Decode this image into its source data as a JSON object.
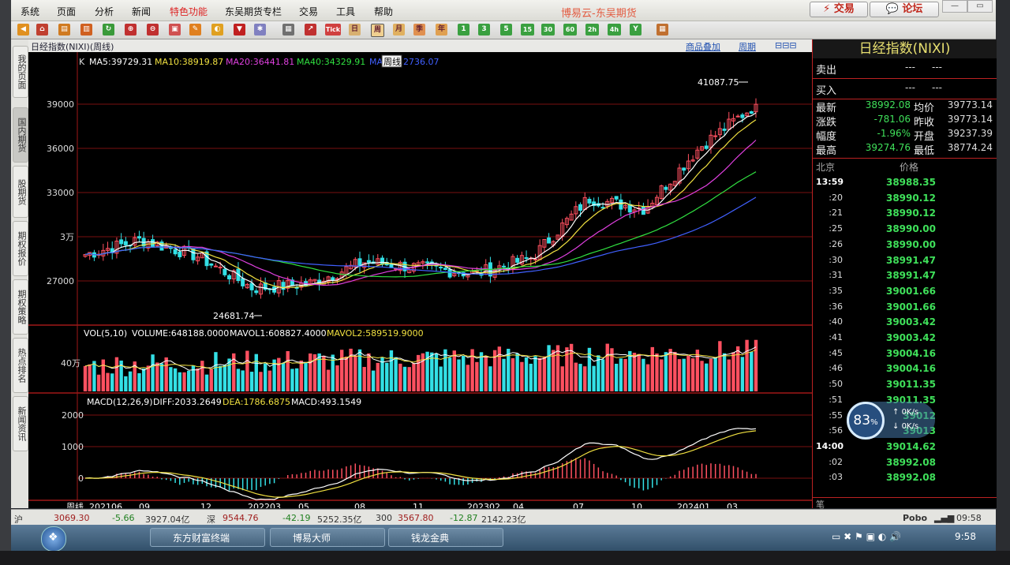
{
  "menu": [
    "系统",
    "页面",
    "分析",
    "新闻",
    "特色功能",
    "东吴期货专栏",
    "交易",
    "工具",
    "帮助"
  ],
  "app_title": "博易云-东吴期货",
  "top_buttons": {
    "trade": "交易",
    "forum": "论坛"
  },
  "toolbar_text": {
    "tick": "Tick",
    "period_buttons": [
      "日",
      "周",
      "月",
      "季",
      "年",
      "1",
      "3",
      "5",
      "15",
      "30",
      "60",
      "2h",
      "4h",
      "Y"
    ]
  },
  "chart": {
    "title": "日经指数(NIXI)(周线)",
    "links": {
      "overlay": "商品叠加",
      "period": "周期"
    },
    "ma_legend": {
      "k": "K",
      "ma5": "MA5:39729.31",
      "ma10": "MA10:38919.87",
      "ma20": "MA20:36441.81",
      "ma40": "MA40:34329.91",
      "ma60_prefix": "MA",
      "ma60": "2736.07"
    },
    "tooltip": "周线",
    "high_label": "41087.75",
    "low_label": "24681.74",
    "y_labels": [
      "39000",
      "36000",
      "33000",
      "3万",
      "27000"
    ],
    "vol_legend": {
      "title": "VOL(5,10)",
      "volume": "VOLUME:648188.0000",
      "mavol1": "MAVOL1:608827.4000",
      "mavol2": "MAVOL2:589519.9000"
    },
    "vol_axis": "40万",
    "macd_legend": {
      "title": "MACD(12,26,9)",
      "diff": "DIFF:2033.2649",
      "dea": "DEA:1786.6875",
      "macd": "MACD:493.1549"
    },
    "macd_axis": [
      "2000",
      "1000",
      "0"
    ],
    "x_labels": [
      "周线",
      "202106",
      "09",
      "12",
      "202203",
      "05",
      "08",
      "11",
      "202302",
      "04",
      "07",
      "10",
      "202401",
      "03"
    ],
    "colors": {
      "up": "#ff5060",
      "down": "#33e0e6",
      "ma5": "#ffffff",
      "ma10": "#f0e040",
      "ma20": "#e040e0",
      "ma40": "#30e040",
      "ma60": "#4060ff",
      "grid": "#a01818"
    }
  },
  "chart_data": {
    "type": "line",
    "title": "日经指数(NIXI)(周线)",
    "approx_close_by_period": {
      "x": [
        "202106",
        "202109",
        "202112",
        "202203",
        "202205",
        "202208",
        "202211",
        "202302",
        "202304",
        "202307",
        "202310",
        "202401",
        "202403"
      ],
      "close": [
        28800,
        29800,
        28700,
        26500,
        26800,
        28300,
        27900,
        27500,
        28600,
        32600,
        31900,
        36100,
        38992
      ]
    },
    "ylim": [
      23500,
      42000
    ],
    "high": 41087.75,
    "low": 24681.74
  },
  "quote": {
    "title": "日经指数(NIXI)",
    "sell_label": "卖出",
    "sell_val": "---",
    "sell_vol": "---",
    "buy_label": "买入",
    "buy_val": "---",
    "buy_vol": "---",
    "rows": [
      {
        "l1": "最新",
        "v1": "38992.08",
        "l2": "均价",
        "v2": "39773.14",
        "c1": "#3fe05a"
      },
      {
        "l1": "涨跌",
        "v1": "-781.06",
        "l2": "昨收",
        "v2": "39773.14",
        "c1": "#3fe05a"
      },
      {
        "l1": "幅度",
        "v1": "-1.96%",
        "l2": "开盘",
        "v2": "39237.39",
        "c1": "#3fe05a"
      },
      {
        "l1": "最高",
        "v1": "39274.76",
        "l2": "最低",
        "v2": "38774.24",
        "c1": "#3fe05a"
      }
    ],
    "ticks_header": {
      "time": "北京",
      "price": "价格"
    },
    "ticks": [
      {
        "t": "13:59",
        "p": "38988.35"
      },
      {
        "t": ":20",
        "p": "38990.12"
      },
      {
        "t": ":21",
        "p": "38990.12"
      },
      {
        "t": ":25",
        "p": "38990.00"
      },
      {
        "t": ":26",
        "p": "38990.00"
      },
      {
        "t": ":30",
        "p": "38991.47"
      },
      {
        "t": ":31",
        "p": "38991.47"
      },
      {
        "t": ":35",
        "p": "39001.66"
      },
      {
        "t": ":36",
        "p": "39001.66"
      },
      {
        "t": ":40",
        "p": "39003.42"
      },
      {
        "t": ":41",
        "p": "39003.42"
      },
      {
        "t": ":45",
        "p": "39004.16"
      },
      {
        "t": ":46",
        "p": "39004.16"
      },
      {
        "t": ":50",
        "p": "39011.35"
      },
      {
        "t": ":51",
        "p": "39011.35"
      },
      {
        "t": ":55",
        "p": "39012"
      },
      {
        "t": ":56",
        "p": "39013"
      },
      {
        "t": "14:00",
        "p": "39014.62"
      },
      {
        "t": ":02",
        "p": "38992.08"
      },
      {
        "t": ":03",
        "p": "38992.08"
      }
    ],
    "bottom_label": "笔"
  },
  "side_tabs": [
    "我的页面",
    "国内期货",
    "股期货",
    "期权报价",
    "期权策略",
    "热点排名",
    "新闻资讯"
  ],
  "speed_widget": {
    "percent": "83",
    "unit": "%",
    "up": "0K/s",
    "down": "0K/s"
  },
  "status": {
    "s1": "3069.30",
    "s2": "-5.66",
    "s3": "3927.04亿",
    "s4": "深",
    "s5": "9544.76",
    "s6": "-42.19",
    "s7": "5252.35亿",
    "s8": "300",
    "s9": "3567.80",
    "s10": "-12.87",
    "s11": "2142.23亿",
    "pobo": "Pobo",
    "clock1": "09:58"
  },
  "taskbar": {
    "apps": [
      "东方财富终端",
      "博易大师",
      "钱龙金典"
    ],
    "clock": "9:58"
  }
}
